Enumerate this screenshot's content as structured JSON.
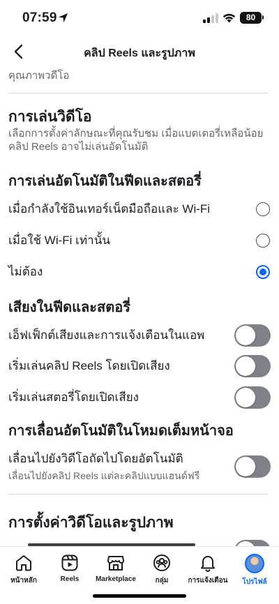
{
  "status_bar": {
    "time": "07:59",
    "battery": "80"
  },
  "header": {
    "title": "คลิป Reels และรูปภาพ"
  },
  "quality_link": "คุณภาพวดีโอ",
  "video_playback": {
    "title": "การเล่นวิดีโอ",
    "description": "เลือกการตั้งค่าลักษณะที่คุณรับชม เมื่อแบตเตอรี่เหลือน้อย คลิป Reels อาจไม่เล่นอัตโนมัติ"
  },
  "autoplay": {
    "title": "การเล่นอัตโนมัติในฟีดและสตอรี่",
    "options": [
      {
        "label": "เมื่อกำลังใช้อินเทอร์เน็ตมือถือและ Wi-Fi",
        "selected": false
      },
      {
        "label": "เมื่อใช้ Wi-Fi เท่านั้น",
        "selected": false
      },
      {
        "label": "ไม่ต้อง",
        "selected": true
      }
    ]
  },
  "sound": {
    "title": "เสียงในฟีดและสตอรี่",
    "toggles": [
      {
        "label": "เอ็ฟเฟ็กต์เสียงและการแจ้งเตือนในแอพ",
        "on": false
      },
      {
        "label": "เริ่มเล่นคลิป Reels โดยเปิดเสียง",
        "on": false
      },
      {
        "label": "เริ่มเล่นสตอรี่โดยเปิดเสียง",
        "on": false
      }
    ]
  },
  "fullscreen": {
    "title": "การเลื่อนอัตโนมัติในโหมดเต็มหน้าจอ",
    "toggle": {
      "label": "เลื่อนไปยังวิดีโอถัดไปโดยอัตโนมัติ",
      "sub": "เลื่อนไปยังคลิป Reels แต่ละคลิปแบบแฮนด์ฟรี",
      "on": false
    }
  },
  "video_photo_settings": {
    "title": "การตั้งค่าวิดีโอและรูปภาพ"
  },
  "tabbar": {
    "items": [
      {
        "label": "หน้าหลัก",
        "icon": "home-icon",
        "active": false
      },
      {
        "label": "Reels",
        "icon": "reels-icon",
        "active": false
      },
      {
        "label": "Marketplace",
        "icon": "marketplace-icon",
        "active": false
      },
      {
        "label": "กลุ่ม",
        "icon": "groups-icon",
        "active": false
      },
      {
        "label": "การแจ้งเตือน",
        "icon": "bell-icon",
        "active": false
      },
      {
        "label": "โปรไฟล์",
        "icon": "avatar",
        "active": true
      }
    ]
  },
  "colors": {
    "accent": "#0866ff",
    "toggle_off": "#7e8188",
    "secondary_text": "#65676b"
  }
}
